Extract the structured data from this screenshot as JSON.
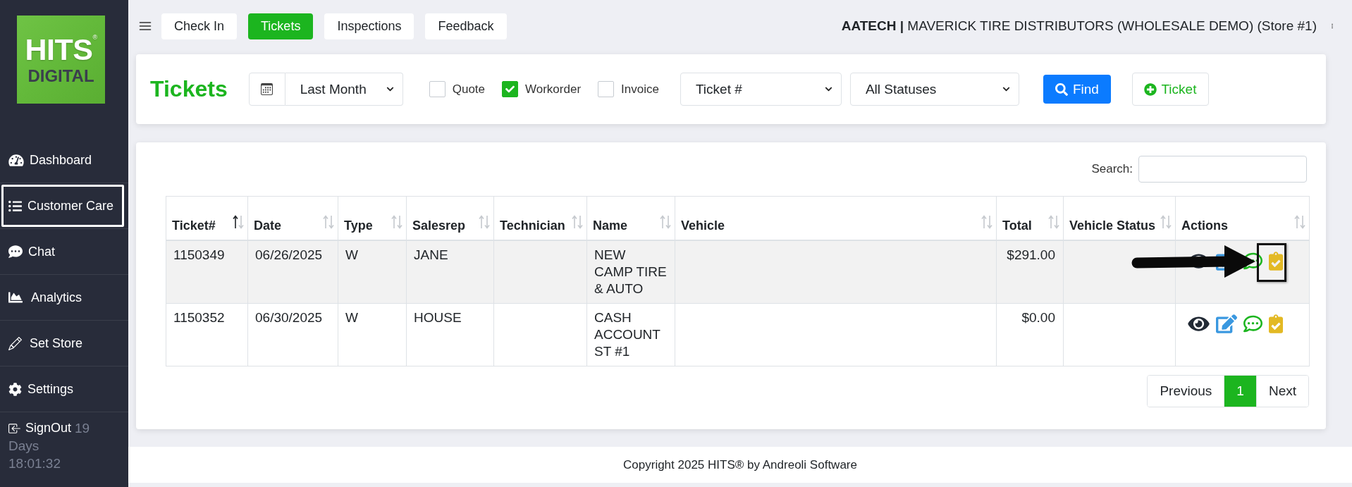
{
  "sidebar": {
    "logo": {
      "title": "HITS$^{®}$",
      "subtitle": "DIGITAL"
    },
    "items": [
      {
        "label": "Dashboard",
        "selected": false
      },
      {
        "label": "Customer Care",
        "selected": true
      },
      {
        "label": "Chat",
        "selected": false
      },
      {
        "label": "Analytics",
        "selected": false
      },
      {
        "label": "Set Store",
        "selected": false
      },
      {
        "label": "Settings",
        "selected": false
      },
      {
        "label": "SignOut",
        "selected": false
      }
    ],
    "countdown": [
      "19",
      "Days",
      "18:01:32"
    ]
  },
  "top_bar": {
    "tabs": [
      {
        "label": "Check In",
        "selected": false
      },
      {
        "label": "Tickets",
        "selected": true
      },
      {
        "label": "Inspections",
        "selected": false
      },
      {
        "label": "Feedback",
        "selected": false
      }
    ],
    "account": "**AATECH |** MAVERICK TIRE DISTRIBUTORS (WHOLESALE DEMO) (Store #1)"
  },
  "filters": {
    "title": "Tickets",
    "date_range": "Last Month",
    "types": [
      {
        "label": "Quote",
        "checked": false
      },
      {
        "label": "Workorder",
        "checked": true
      },
      {
        "label": "Invoice",
        "checked": false
      }
    ],
    "search_by": "Ticket #",
    "status": "All Statuses",
    "find_button": "Find",
    "new_ticket_button": "Ticket"
  },
  "table": {
    "search_label": "Search:",
    "columns": [
      {
        "label": "Ticket#",
        "sorted": true
      },
      {
        "label": "Date",
        "sorted": false
      },
      {
        "label": "Type",
        "sorted": false
      },
      {
        "label": "Salesrep",
        "sorted": false
      },
      {
        "label": "Technician",
        "sorted": false
      },
      {
        "label": "Name",
        "sorted": false
      },
      {
        "label": "Vehicle",
        "sorted": false
      },
      {
        "label": "Total",
        "sorted": false
      },
      {
        "label": "Vehicle Status",
        "sorted": false
      },
      {
        "label": "Actions",
        "sorted": false
      }
    ],
    "rows": [
      {
        "ticket": "1150349",
        "date": "06/26/2025",
        "type": "W",
        "salesrep": "JANE",
        "name": "NEW CAMP TIRE & AUTO",
        "total": "$291.00",
        "callout": true
      },
      {
        "ticket": "1150352",
        "date": "06/30/2025",
        "type": "W",
        "salesrep": "HOUSE",
        "name": "CASH ACCOUNT ST #1",
        "total": "$0.00",
        "callout": false
      }
    ]
  },
  "pagination": {
    "previous": "Previous",
    "pages": [
      {
        "label": "1",
        "selected": true
      }
    ],
    "next": "Next"
  },
  "footer": "Copyright 2025 HITS® by Andreoli Software"
}
